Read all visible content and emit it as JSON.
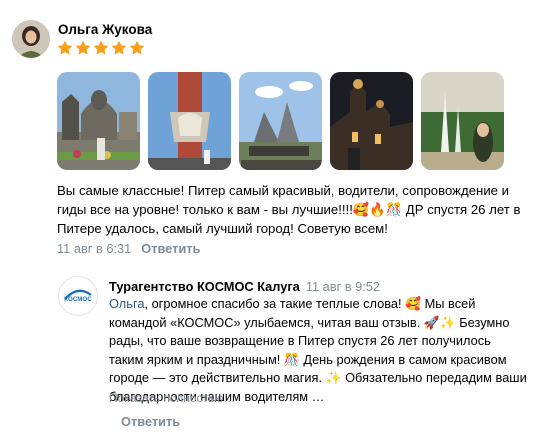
{
  "review": {
    "author": "Ольга Жукова",
    "rating": 5,
    "photos": [
      "photo-1",
      "photo-2",
      "photo-3",
      "photo-4",
      "photo-5"
    ],
    "text": "Вы самые классные! Питер самый красивый, водители, сопровождение и гиды все на уровне! только к вам - вы лучшие!!!!🥰🔥🎊 ДР спустя 26 лет в Питере удалось, самый лучший город! Советую всем!",
    "date": "11 авг в 6:31",
    "reply_label": "Ответить"
  },
  "company_reply": {
    "author": "Турагентство КОСМОС Калуга",
    "date": "11 авг в 9:52",
    "logo_text": "КОСМОС",
    "mention": "Ольга",
    "text": ", огромное спасибо за такие теплые слова! 🥰 Мы всей командой «КОСМОС» улыбаемся, читая ваш отзыв. 🚀✨ Безумно рады, что ваше возвращение в Питер спустя 26 лет получилось таким ярким и праздничным! 🎊 День рождения в самом красивом городе — это действительно магия. ✨ Обязательно передадим ваши благодарности нашим водителям …",
    "show_more": "Показать полностью…",
    "reply_label": "Ответить"
  },
  "colors": {
    "star": "#f8a01c",
    "link": "#2a5885",
    "secondary_text": "#818c99"
  }
}
